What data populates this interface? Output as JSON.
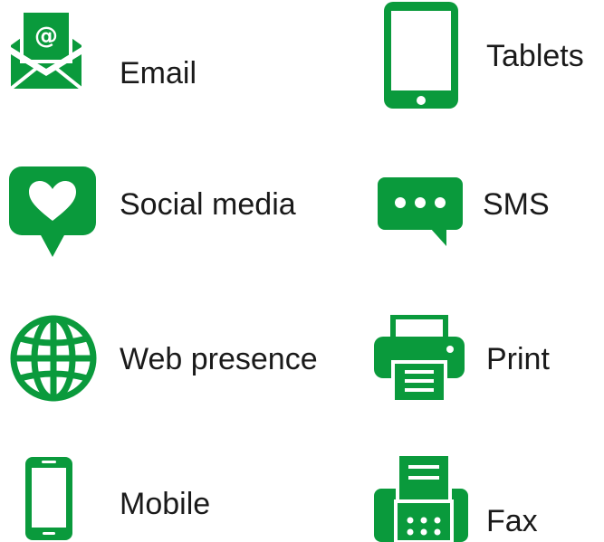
{
  "accent_color": "#0a9a3c",
  "items": [
    {
      "label": "Email",
      "icon": "email-icon"
    },
    {
      "label": "Tablets",
      "icon": "tablet-icon"
    },
    {
      "label": "Social media",
      "icon": "social-media-icon"
    },
    {
      "label": "SMS",
      "icon": "sms-icon"
    },
    {
      "label": "Web presence",
      "icon": "globe-icon"
    },
    {
      "label": "Print",
      "icon": "printer-icon"
    },
    {
      "label": "Mobile",
      "icon": "mobile-phone-icon"
    },
    {
      "label": "Fax",
      "icon": "fax-icon"
    }
  ]
}
